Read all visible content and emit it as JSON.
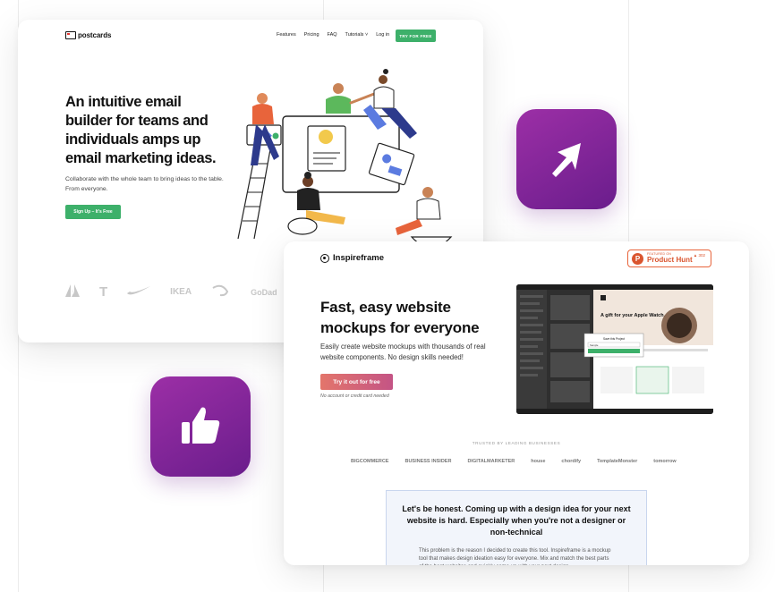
{
  "postcards": {
    "logo": "postcards",
    "nav": [
      "Features",
      "Pricing",
      "FAQ",
      "Tutorials ˅",
      "Log in"
    ],
    "cta": "TRY FOR FREE",
    "headline": "An intuitive email builder for teams and individuals amps up email marketing ideas.",
    "subtext": "Collaborate with the whole team to bring ideas to the table. From everyone.",
    "signup_button": "Sign Up – It's Free",
    "brand_logos": [
      "T",
      "IKEA",
      "GoDad"
    ],
    "accent": "#3db06a"
  },
  "app_icons": {
    "send_gradient": [
      "#9c2fa6",
      "#6a1d8c"
    ],
    "like_gradient": [
      "#9c2fa6",
      "#6a1d8c"
    ]
  },
  "inspireframe": {
    "logo": "Inspireframe",
    "product_hunt": {
      "small": "FEATURED ON",
      "label": "Product Hunt",
      "votes": "▲ 302"
    },
    "headline": "Fast, easy website mockups for everyone",
    "subtext": "Easily create website mockups with thousands of real website components. No design skills needed!",
    "cta": "Try it out for free",
    "note": "No account or credit card needed",
    "trusted_label": "TRUSTED BY LEADING BUSINESSES",
    "trusted_logos": [
      "BIGCOMMERCE",
      "BUSINESS INSIDER",
      "DIGITALMARKETER",
      "house",
      "chordify",
      "TemplateMonster",
      "tomorrow"
    ],
    "panel_heading": "Let's be honest. Coming up with a design idea for your next website is hard. Especially when you're not a designer or non-technical",
    "panel_body": "This problem is the reason I decided to create this tool. Inspireframe is a mockup tool that makes design ideation easy for everyone. Mix and match the best parts of the best websites and quickly come up with your next design.",
    "screenshot_text": {
      "hero": "A gift for your Apple Watch.",
      "modal_title": "Save this Project",
      "modal_field": "Sample"
    },
    "brand_color": "#da552f"
  }
}
